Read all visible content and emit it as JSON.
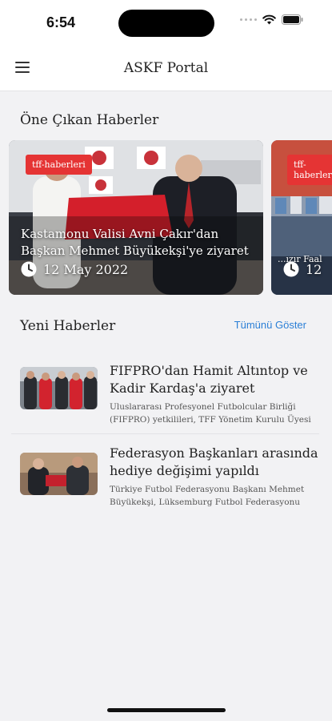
{
  "status_bar": {
    "time": "6:54"
  },
  "header": {
    "title": "ASKF Portal",
    "menu_icon": "hamburger-menu-icon"
  },
  "featured": {
    "section_title": "Öne Çıkan Haberler",
    "items": [
      {
        "tag": "tff-haberleri",
        "title": "Kastamonu Valisi Avni Çakır'dan Başkan Mehmet Büyükekşi'ye ziyaret",
        "date": "12 May 2022"
      },
      {
        "tag": "tff-haberleri",
        "title": "...ızır Faal",
        "date": "12"
      }
    ],
    "tag_color": "#e53434"
  },
  "news": {
    "section_title": "Yeni Haberler",
    "show_all_label": "Tümünü Göster",
    "show_all_color": "#2b7fd6",
    "items": [
      {
        "title": "FIFPRO'dan Hamit Altıntop ve Kadir Kardaş'a ziyaret",
        "summary": "Uluslararası Profesyonel Futbolcular Birliği (FIFPRO) yetkilileri, TFF Yönetim Kurulu Üyesi"
      },
      {
        "title": "Federasyon Başkanları arasında hediye değişimi yapıldı",
        "summary": "Türkiye Futbol Federasyonu Başkanı Mehmet Büyükekşi, Lüksemburg Futbol Federasyonu"
      }
    ]
  }
}
